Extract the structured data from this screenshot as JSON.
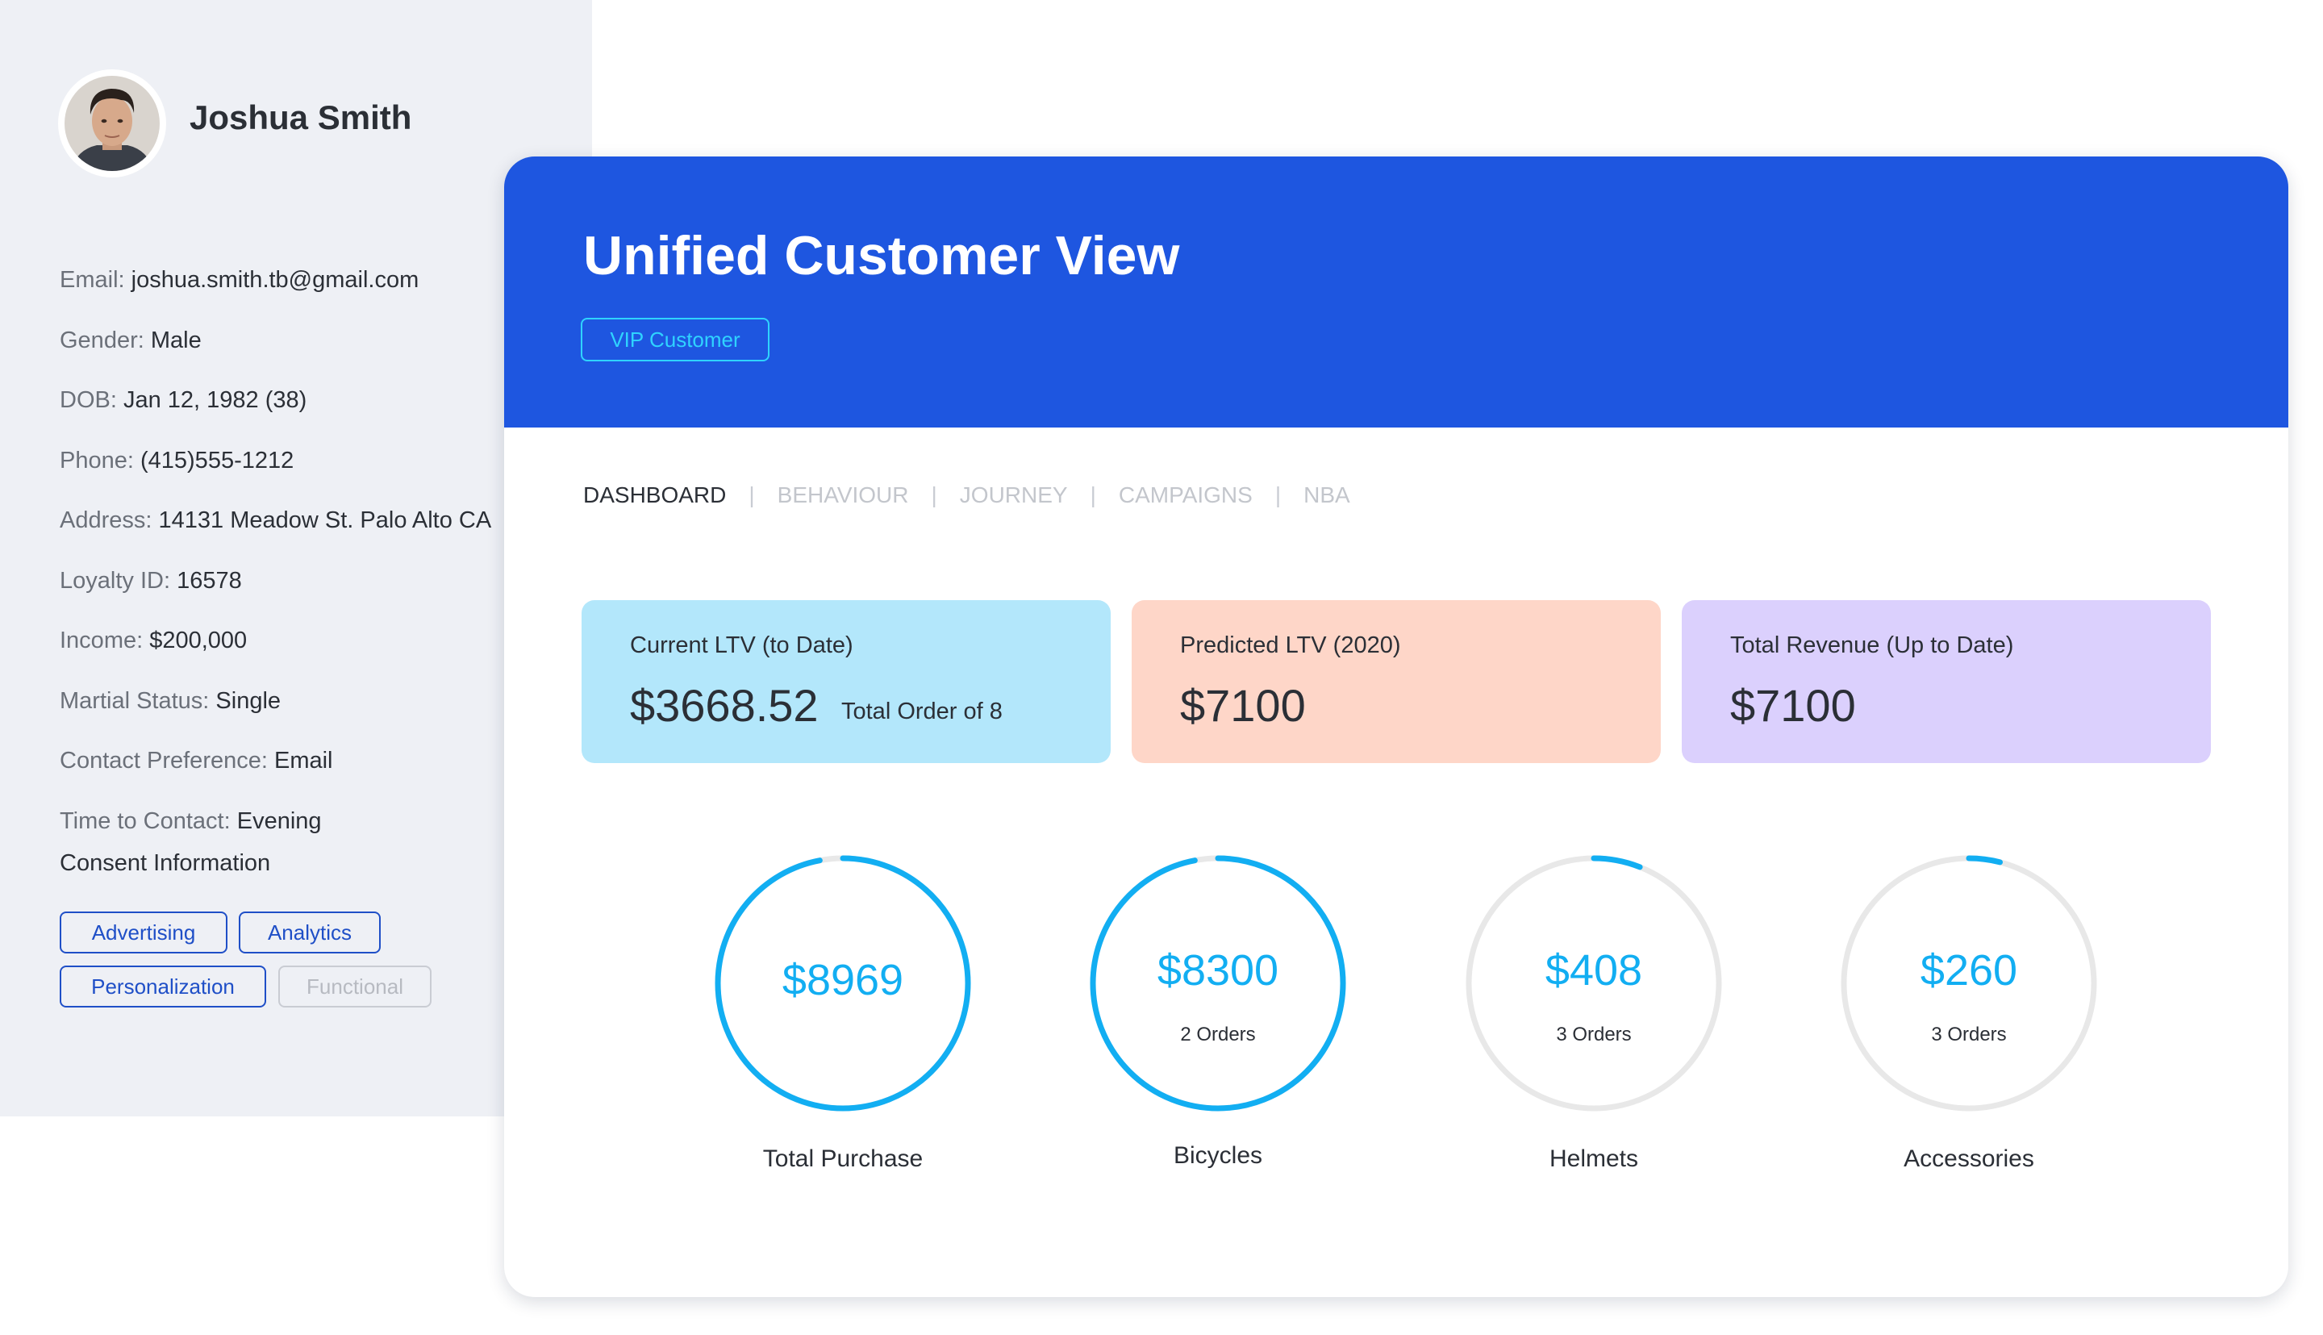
{
  "profile": {
    "name": "Joshua Smith",
    "fields": [
      {
        "label": "Email:",
        "value": "joshua.smith.tb@gmail.com"
      },
      {
        "label": "Gender:",
        "value": "Male"
      },
      {
        "label": "DOB:",
        "value": "Jan 12, 1982 (38)"
      },
      {
        "label": "Phone:",
        "value": "(415)555-1212"
      },
      {
        "label": "Address:",
        "value": "14131 Meadow St. Palo Alto CA"
      },
      {
        "label": "Loyalty ID:",
        "value": "16578"
      },
      {
        "label": "Income:",
        "value": "$200,000"
      },
      {
        "label": "Martial Status:",
        "value": "Single"
      },
      {
        "label": "Contact Preference:",
        "value": "Email"
      },
      {
        "label": "Time to Contact:",
        "value": "Evening"
      }
    ],
    "consent_title": "Consent Information",
    "consents": [
      {
        "label": "Advertising",
        "active": true
      },
      {
        "label": "Analytics",
        "active": true
      },
      {
        "label": "Personalization",
        "active": true
      },
      {
        "label": "Functional",
        "active": false
      }
    ]
  },
  "header": {
    "title": "Unified Customer View",
    "badge": "VIP Customer"
  },
  "tabs": [
    {
      "label": "DASHBOARD",
      "active": true
    },
    {
      "label": "BEHAVIOUR",
      "active": false
    },
    {
      "label": "JOURNEY",
      "active": false
    },
    {
      "label": "CAMPAIGNS",
      "active": false
    },
    {
      "label": "NBA",
      "active": false
    }
  ],
  "kpis": [
    {
      "label": "Current LTV (to Date)",
      "value": "$3668.52",
      "sub": "Total Order of 8",
      "color": "#b3e7fb"
    },
    {
      "label": "Predicted LTV (2020)",
      "value": "$7100",
      "color": "#fed6c8"
    },
    {
      "label": "Total Revenue (Up to Date)",
      "value": "$7100",
      "color": "#dbd0fd"
    }
  ],
  "rings": [
    {
      "value": "$8969",
      "orders": "",
      "caption": "Total Purchase",
      "progress": 0.97
    },
    {
      "value": "$8300",
      "orders": "2 Orders",
      "caption": "Bicycles",
      "progress": 0.97
    },
    {
      "value": "$408",
      "orders": "3 Orders",
      "caption": "Helmets",
      "progress": 0.06
    },
    {
      "value": "$260",
      "orders": "3 Orders",
      "caption": "Accessories",
      "progress": 0.04
    }
  ],
  "colors": {
    "accent": "#1e56e0",
    "ring_fill": "#12aef2",
    "ring_track": "#e8e8e8",
    "chip_active": "#1f4fc7",
    "chip_inactive": "#c9ccd3",
    "vip_badge": "#2fd3ff"
  }
}
